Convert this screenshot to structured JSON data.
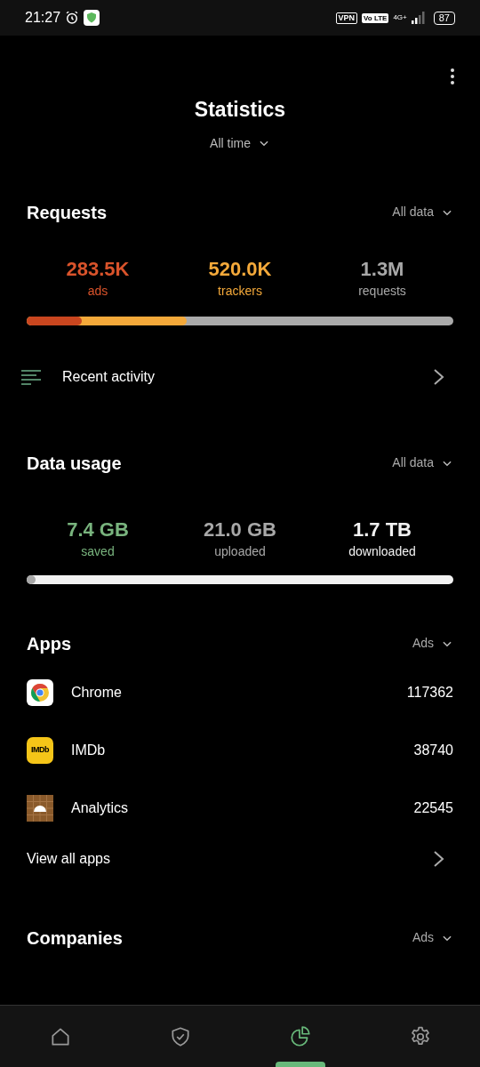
{
  "status_bar": {
    "time": "21:27",
    "vpn": "VPN",
    "volte": "Vo LTE",
    "network": "4G+",
    "battery": "87"
  },
  "header": {
    "title": "Statistics",
    "period": "All time"
  },
  "requests": {
    "title": "Requests",
    "filter": "All data",
    "stats": [
      {
        "value": "283.5K",
        "label": "ads",
        "color": "#d9532b"
      },
      {
        "value": "520.0K",
        "label": "trackers",
        "color": "#f4a93a"
      },
      {
        "value": "1.3M",
        "label": "requests",
        "color": "#a8a8a8"
      }
    ],
    "bar": [
      {
        "color": "#c9461f",
        "level": 0.13
      },
      {
        "color": "#f4a93a",
        "level": 0.375
      }
    ],
    "recent_activity": "Recent activity"
  },
  "data_usage": {
    "title": "Data usage",
    "filter": "All data",
    "stats": [
      {
        "value": "7.4 GB",
        "label": "saved",
        "color": "#79b47e"
      },
      {
        "value": "21.0 GB",
        "label": "uploaded",
        "color": "#a8a8a8"
      },
      {
        "value": "1.7 TB",
        "label": "downloaded",
        "color": "#f2f2f2"
      }
    ],
    "bar": [
      {
        "color": "#a8a8a8",
        "level": 0.02
      }
    ]
  },
  "apps": {
    "title": "Apps",
    "filter": "Ads",
    "items": [
      {
        "kind": "chrome",
        "name": "Chrome",
        "count": "117362"
      },
      {
        "kind": "imdb",
        "name": "IMDb",
        "badge": "IMDb",
        "count": "38740"
      },
      {
        "kind": "android",
        "name": "Analytics",
        "count": "22545"
      }
    ],
    "view_all": "View all apps"
  },
  "companies": {
    "title": "Companies",
    "filter": "Ads"
  },
  "nav": [
    {
      "kind": "home",
      "selected": false
    },
    {
      "kind": "shield",
      "selected": false
    },
    {
      "kind": "stats",
      "selected": true
    },
    {
      "kind": "settings",
      "selected": false
    }
  ]
}
